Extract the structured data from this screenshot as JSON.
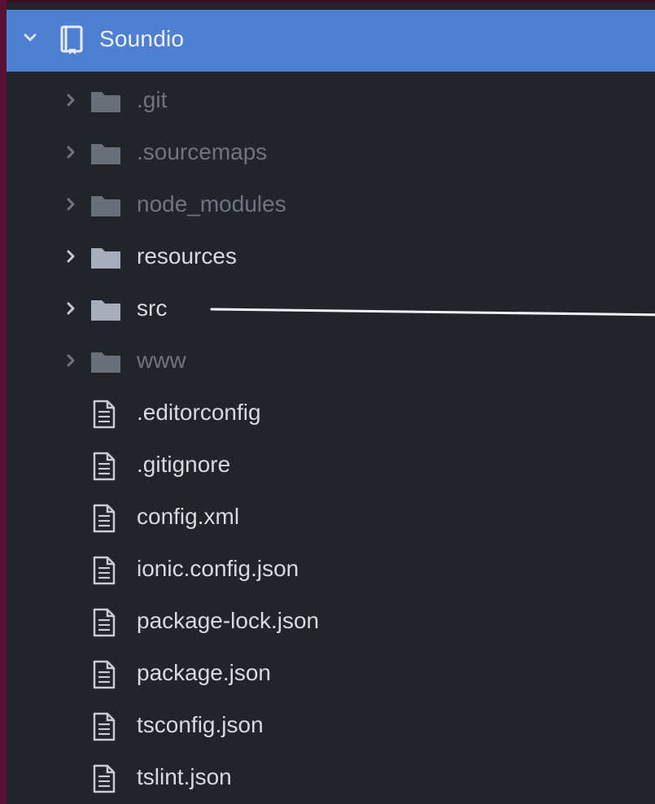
{
  "window": {
    "root": {
      "label": "Soundio",
      "expanded": true,
      "icon": "book-icon"
    },
    "entries": [
      {
        "type": "folder",
        "label": ".git",
        "dimmed": true,
        "icon": "folder-icon"
      },
      {
        "type": "folder",
        "label": ".sourcemaps",
        "dimmed": true,
        "icon": "folder-icon"
      },
      {
        "type": "folder",
        "label": "node_modules",
        "dimmed": true,
        "icon": "folder-icon"
      },
      {
        "type": "folder",
        "label": "resources",
        "dimmed": false,
        "icon": "folder-icon"
      },
      {
        "type": "folder",
        "label": "src",
        "dimmed": false,
        "icon": "folder-icon"
      },
      {
        "type": "folder",
        "label": "www",
        "dimmed": true,
        "icon": "folder-icon"
      },
      {
        "type": "file",
        "label": ".editorconfig",
        "dimmed": false,
        "icon": "file-text-icon"
      },
      {
        "type": "file",
        "label": ".gitignore",
        "dimmed": false,
        "icon": "file-text-icon"
      },
      {
        "type": "file",
        "label": "config.xml",
        "dimmed": false,
        "icon": "file-text-icon"
      },
      {
        "type": "file",
        "label": "ionic.config.json",
        "dimmed": false,
        "icon": "file-text-icon"
      },
      {
        "type": "file",
        "label": "package-lock.json",
        "dimmed": false,
        "icon": "file-text-icon"
      },
      {
        "type": "file",
        "label": "package.json",
        "dimmed": false,
        "icon": "file-text-icon"
      },
      {
        "type": "file",
        "label": "tsconfig.json",
        "dimmed": false,
        "icon": "file-text-icon"
      },
      {
        "type": "file",
        "label": "tslint.json",
        "dimmed": false,
        "icon": "file-text-icon"
      }
    ]
  },
  "colors": {
    "selection": "#4f7fd1",
    "panel": "#21252b",
    "text": "#d6dae2",
    "dimmed_text": "#6f7580",
    "folder": "#a7adba",
    "dimmed_folder": "#6a707b"
  }
}
